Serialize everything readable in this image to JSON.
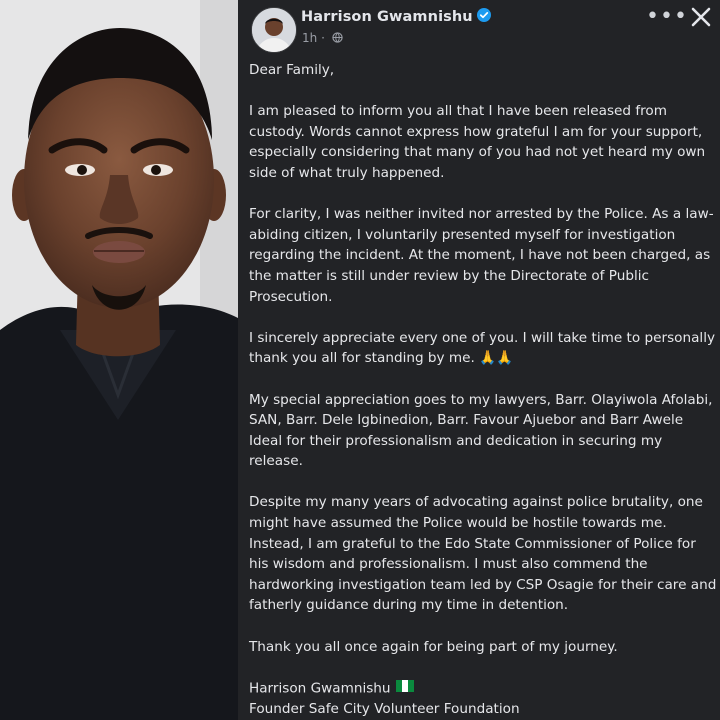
{
  "post": {
    "author": "Harrison Gwamnishu",
    "time": "1h",
    "time_separator": "·",
    "more_label": "•••",
    "greeting": "Dear Family,",
    "paragraphs": [
      "I am pleased to inform you all that I have been released from custody. Words cannot express how grateful I am for your support, especially considering that many of you had not yet heard my own side of what truly happened.",
      "For clarity, I was neither invited nor arrested by the Police. As a law-abiding citizen, I voluntarily presented myself for investigation regarding the incident. At the moment, I have not been charged, as the matter is still under review by the Directorate of Public Prosecution.",
      "I sincerely appreciate every one of you. I will take time to personally thank you all for standing by me. 🙏🙏",
      "My special appreciation goes to my lawyers, Barr. Olayiwola Afolabi, SAN, Barr. Dele Igbinedion, Barr. Favour Ajuebor and Barr Awele Ideal for their professionalism and dedication in securing my release.",
      "Despite my many years of advocating against police brutality, one might have assumed the Police would be hostile towards me. Instead, I am grateful to the Edo State Commissioner of Police for his wisdom and professionalism. I must also commend the hardworking investigation team led by CSP Osagie for their care and fatherly guidance during my time in detention.",
      "Thank you all once again for being part of my journey."
    ],
    "signature_name": "Harrison Gwamnishu",
    "signature_title": "Founder Safe City Volunteer Foundation"
  },
  "colors": {
    "panel_bg": "#222326",
    "text": "#e6e7ea",
    "meta": "#9a9ea6",
    "verified": "#1d9bf0"
  },
  "icons": [
    "verified-badge-icon",
    "globe-icon",
    "more-icon",
    "close-icon",
    "nigeria-flag-icon"
  ]
}
